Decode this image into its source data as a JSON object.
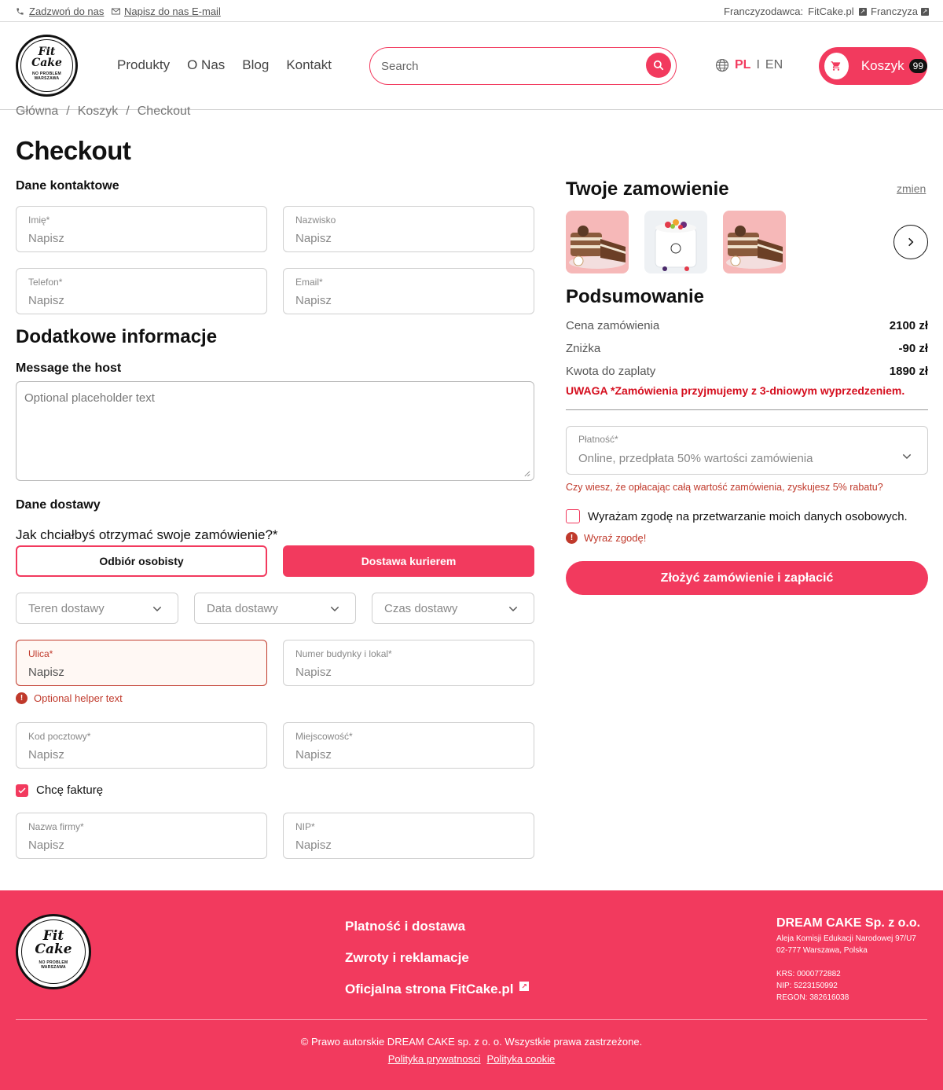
{
  "topbar": {
    "call": "Zadzwoń do nas",
    "email": "Napisz do nas E-mail",
    "franchisor_label": "Franczyzodawca:",
    "franchisor_link": "FitCake.pl",
    "franchise": "Franczyza"
  },
  "logo": {
    "text": "Fit Cake",
    "sub1": "NO SUGAR",
    "sub2": "NO PROBLEM",
    "sub3": "WARSZAWA",
    "sub4": "DESERS"
  },
  "nav": [
    "Produkty",
    "O Nas",
    "Blog",
    "Kontakt"
  ],
  "search": {
    "placeholder": "Search"
  },
  "lang": {
    "pl": "PL",
    "sep": "I",
    "en": "EN"
  },
  "cart": {
    "label": "Koszyk",
    "count": "99"
  },
  "breadcrumb": [
    "Główna",
    "/",
    "Koszyk",
    "/",
    "Checkout"
  ],
  "page_title": "Checkout",
  "contact": {
    "heading": "Dane kontaktowe",
    "first_name": {
      "label": "Imię*",
      "placeholder": "Napisz"
    },
    "last_name": {
      "label": "Nazwisko",
      "placeholder": "Napisz"
    },
    "phone": {
      "label": "Telefon*",
      "placeholder": "Napisz"
    },
    "email": {
      "label": "Email*",
      "placeholder": "Napisz"
    }
  },
  "extra": {
    "heading": "Dodatkowe informacje",
    "message_label": "Message the host",
    "message_placeholder": "Optional placeholder text"
  },
  "delivery": {
    "heading": "Dane dostawy",
    "question": "Jak chciałbyś otrzymać swoje zamówienie?*",
    "pickup": "Odbiór osobisty",
    "courier": "Dostawa kurierem",
    "area": "Teren dostawy",
    "date": "Data dostawy",
    "time": "Czas dostawy",
    "street": {
      "label": "Ulica*",
      "placeholder": "Napisz"
    },
    "street_helper": "Optional helper text",
    "building": {
      "label": "Numer budynky i lokal*",
      "placeholder": "Napisz"
    },
    "postal": {
      "label": "Kod pocztowy*",
      "placeholder": "Napisz"
    },
    "city": {
      "label": "Miejscowość*",
      "placeholder": "Napisz"
    },
    "invoice": "Chcę fakturę",
    "company": {
      "label": "Nazwa firmy*",
      "placeholder": "Napisz"
    },
    "nip": {
      "label": "NIP*",
      "placeholder": "Napisz"
    }
  },
  "order": {
    "heading": "Twoje zamowienie",
    "change": "zmien"
  },
  "summary": {
    "heading": "Podsumowanie",
    "rows": [
      {
        "label": "Cena zamówienia",
        "value": "2100 zł"
      },
      {
        "label": "Zniżka",
        "value": "-90 zł"
      },
      {
        "label": "Kwota do zaplaty",
        "value": "1890 zł"
      }
    ],
    "warning": "UWAGA *Zamówienia przyjmujemy z 3-dniowym wyprzedzeniem.",
    "payment_label": "Płatność*",
    "payment_value": "Online, przedpłata 50% wartości zamówienia",
    "promo": "Czy wiesz, że opłacając całą wartość zamówienia, zyskujesz 5% rabatu?",
    "consent": "Wyrażam zgodę na przetwarzanie moich danych osobowych.",
    "consent_error": "Wyraź zgodę!",
    "submit": "Złożyć zamówienie i zapłacić"
  },
  "footer": {
    "links": [
      "Platność i dostawa",
      "Zwroty i reklamacje",
      "Oficjalna strona FitCake.pl"
    ],
    "company_name": "DREAM CAKE Sp. z o.o.",
    "address1": "Aleja Komisji Edukacji Narodowej 97/U7",
    "address2": "02-777 Warszawa, Polska",
    "krs": "KRS: 0000772882",
    "nip": "NIP: 5223150992",
    "regon": "REGON: 382616038",
    "copyright": "© Prawo autorskie DREAM CAKE sp. z o. o. Wszystkie prawa zastrzeżone.",
    "privacy": "Polityka prywatnosci",
    "cookie": "Polityka cookie"
  },
  "colors": {
    "accent": "#f23a5e",
    "error": "#c0392b",
    "warning": "#d50e1e"
  }
}
